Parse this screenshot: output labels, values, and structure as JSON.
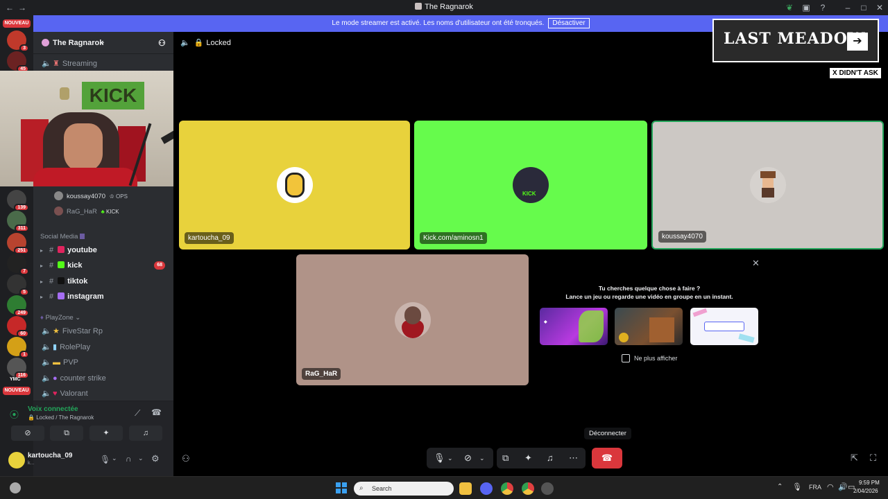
{
  "window": {
    "title": "The Ragnarok"
  },
  "banner": {
    "text": "Le mode streamer est activé. Les noms d'utilisateur ont été tronqués.",
    "button": "Désactiver"
  },
  "servers": {
    "nouveau_top": "NOUVEAU",
    "nouveau_bottom": "NOUVEAU",
    "badges": [
      "3",
      "45",
      "139",
      "311",
      "251",
      "7",
      "5",
      "249",
      "60",
      "1",
      "116"
    ],
    "ymc_label": "YMC"
  },
  "sidebar": {
    "guild_name": "The Ragnarok",
    "streaming_channel": "Streaming",
    "voice_users": [
      {
        "name": "koussay4070",
        "tag": "OPS"
      },
      {
        "name": "RaG_HaR",
        "tag": "KICK"
      }
    ],
    "categories": {
      "social": "Social Media",
      "playzone": "PlayZone"
    },
    "text_channels": [
      {
        "label": "youtube",
        "color": "#e0245e"
      },
      {
        "label": "kick",
        "color": "#53fc18"
      },
      {
        "label": "tiktok",
        "color": "#000000"
      },
      {
        "label": "instagram",
        "color": "#a56df2"
      }
    ],
    "kick_badge": "68",
    "voice_channels": [
      "FiveStar Rp",
      "RolePlay",
      "PVP",
      "counter strike",
      "Valorant"
    ]
  },
  "voice_panel": {
    "status": "Voix connectée",
    "location": "Locked / The Ragnarok",
    "user": "kartoucha_09",
    "user_sub": "k..."
  },
  "stage": {
    "channel_name": "Locked",
    "participants": [
      {
        "name": "kartoucha_09",
        "bg": "#e8d23c"
      },
      {
        "name": "Kick.com/aminosn1",
        "bg": "#66fb4c"
      },
      {
        "name": "koussay4070",
        "bg": "#ccc8c4"
      },
      {
        "name": "RaG_HaR",
        "bg": "#b09388"
      }
    ],
    "activity": {
      "line1": "Tu cherches quelque chose à faire ?",
      "line2": "Lance un jeu ou regarde une vidéo en groupe en un instant.",
      "dont_show": "Ne plus afficher"
    },
    "disconnect_tooltip": "Déconnecter"
  },
  "overlay": {
    "brand": "LAST MEADOW",
    "tag": "X DIDN'T ASK",
    "webcam_sign": "KICK"
  },
  "taskbar": {
    "search_placeholder": "Search",
    "lang": "FRA",
    "time": "9:59 PM",
    "date": "2/04/2026"
  },
  "colors": {
    "blurple": "#5865f2",
    "danger": "#da373c",
    "bg_dark": "#1e1f22",
    "sidebar": "#2b2d31"
  }
}
